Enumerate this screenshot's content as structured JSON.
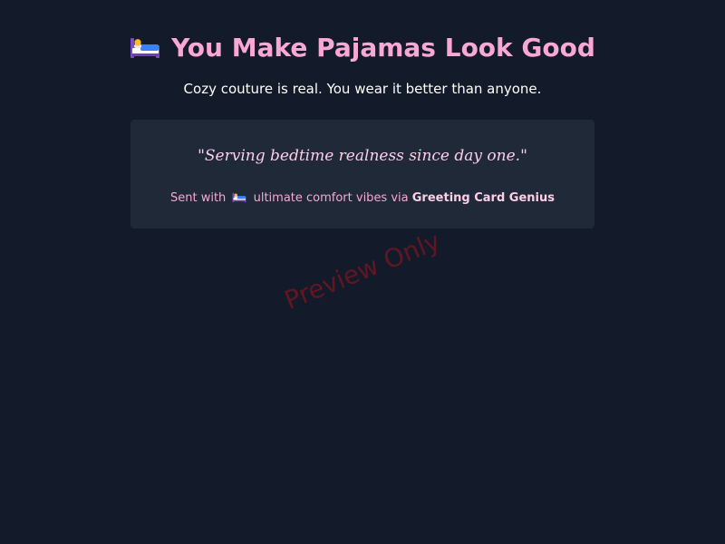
{
  "header": {
    "emoji": "bed-emoji",
    "title": "You Make Pajamas Look Good",
    "subtitle": "Cozy couture is real. You wear it better than anyone."
  },
  "card": {
    "quote": "\"Serving bedtime realness since day one.\"",
    "signoff_prefix": "Sent with",
    "signoff_emoji": "bed-emoji",
    "signoff_middle": "ultimate comfort vibes via",
    "signoff_brand": "Greeting Card Genius"
  },
  "watermark": "Preview Only",
  "colors": {
    "background": "#131a29",
    "card_background": "#1f2937",
    "accent_pink": "#f9a8d4",
    "light_pink": "#fbcfe8",
    "watermark_red": "#8c141e"
  }
}
